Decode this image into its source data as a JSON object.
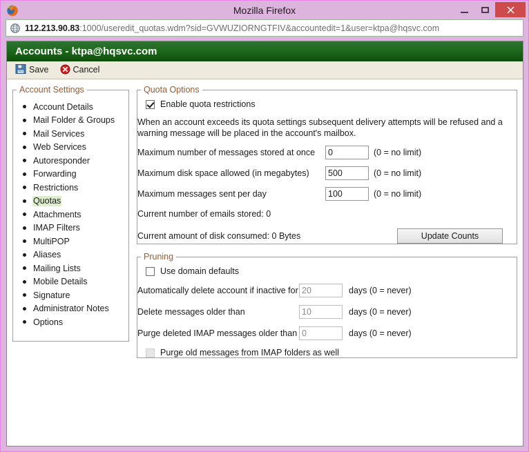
{
  "window": {
    "title": "Mozilla Firefox",
    "controls": {
      "minimize": "–",
      "maximize": "□",
      "close": "✕"
    }
  },
  "urlbar": {
    "host": "112.213.90.83",
    "rest": ":1000/useredit_quotas.wdm?sid=GVWUZIORNGTFIV&accountedit=1&user=ktpa@hqsvc.com",
    "full": "112.213.90.83:1000/useredit_quotas.wdm?sid=GVWUZIORNGTFIV&accountedit=1&user=ktpa@hqsvc.com"
  },
  "header": {
    "title": "Accounts - ktpa@hqsvc.com"
  },
  "toolbar": {
    "save_label": "Save",
    "cancel_label": "Cancel"
  },
  "sidebar": {
    "legend": "Account Settings",
    "items": [
      {
        "label": "Account Details",
        "active": false
      },
      {
        "label": "Mail Folder & Groups",
        "active": false
      },
      {
        "label": "Mail Services",
        "active": false
      },
      {
        "label": "Web Services",
        "active": false
      },
      {
        "label": "Autoresponder",
        "active": false
      },
      {
        "label": "Forwarding",
        "active": false
      },
      {
        "label": "Restrictions",
        "active": false
      },
      {
        "label": "Quotas",
        "active": true
      },
      {
        "label": "Attachments",
        "active": false
      },
      {
        "label": "IMAP Filters",
        "active": false
      },
      {
        "label": "MultiPOP",
        "active": false
      },
      {
        "label": "Aliases",
        "active": false
      },
      {
        "label": "Mailing Lists",
        "active": false
      },
      {
        "label": "Mobile Details",
        "active": false
      },
      {
        "label": "Signature",
        "active": false
      },
      {
        "label": "Administrator Notes",
        "active": false
      },
      {
        "label": "Options",
        "active": false
      }
    ]
  },
  "quota": {
    "legend": "Quota Options",
    "enable_label": "Enable quota restrictions",
    "enable_checked": true,
    "blurb": "When an account exceeds its quota settings subsequent delivery attempts will be refused and a warning message will be placed in the account's mailbox.",
    "max_messages_label": "Maximum number of messages stored at once",
    "max_messages_value": "0",
    "max_messages_suffix": "(0 = no limit)",
    "max_disk_label": "Maximum disk space allowed (in megabytes)",
    "max_disk_value": "500",
    "max_disk_suffix": "(0 = no limit)",
    "max_sent_label": "Maximum messages sent per day",
    "max_sent_value": "100",
    "max_sent_suffix": "(0 = no limit)",
    "current_emails_label": "Current number of emails stored:  0",
    "current_disk_label": "Current amount of disk consumed:  0 Bytes",
    "update_counts_label": "Update Counts"
  },
  "pruning": {
    "legend": "Pruning",
    "use_defaults_label": "Use domain defaults",
    "use_defaults_checked": false,
    "inactive_label": "Automatically delete account if inactive for",
    "inactive_value": "20",
    "inactive_suffix": "days (0 = never)",
    "delete_older_label": "Delete messages older than",
    "delete_older_value": "10",
    "delete_older_suffix": "days (0 = never)",
    "purge_imap_label": "Purge deleted IMAP messages older than",
    "purge_imap_value": "0",
    "purge_imap_suffix": "days (0 = never)",
    "purge_folders_label": "Purge old messages from IMAP folders as well",
    "purge_folders_checked": false
  },
  "colors": {
    "window_frame": "#ddb4dd",
    "header_green": "#1d6a1c",
    "toolbar_bg": "#efeade",
    "legend_text": "#9c5a2e",
    "active_item_bg": "#dceecb",
    "close_button": "#cf4b4b"
  }
}
